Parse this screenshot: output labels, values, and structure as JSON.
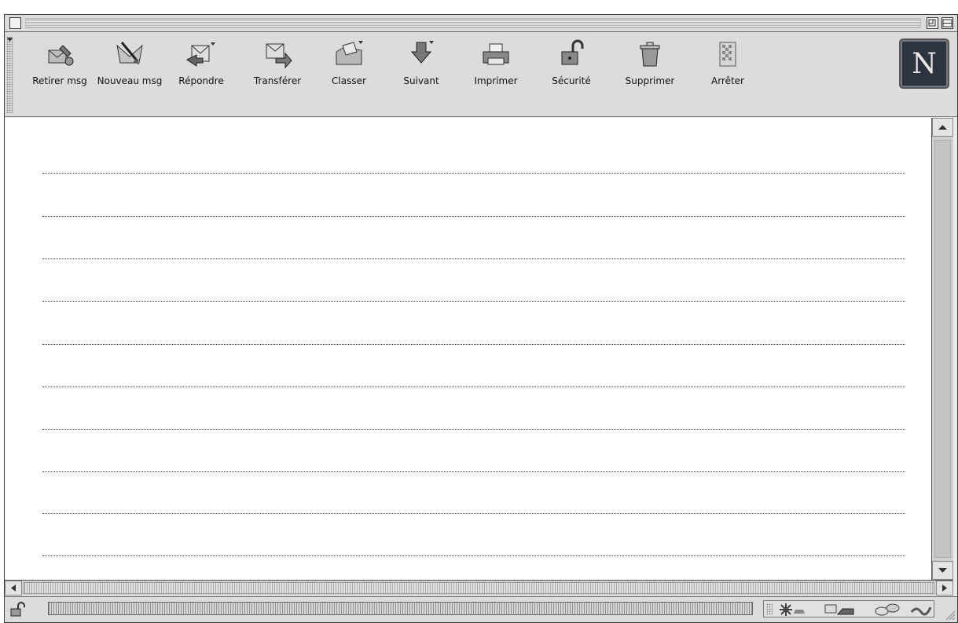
{
  "window": {
    "title": "",
    "close_icon": "close-box-icon",
    "zoom_icon": "zoom-box-icon",
    "collapse_icon": "collapse-box-icon"
  },
  "toolbar": {
    "buttons": [
      {
        "id": "get-msg",
        "label": "Retirer msg",
        "icon": "get-mail-icon"
      },
      {
        "id": "new-msg",
        "label": "Nouveau msg",
        "icon": "new-message-icon"
      },
      {
        "id": "reply",
        "label": "Répondre",
        "icon": "reply-icon"
      },
      {
        "id": "forward",
        "label": "Transférer",
        "icon": "forward-icon"
      },
      {
        "id": "file",
        "label": "Classer",
        "icon": "file-folder-icon"
      },
      {
        "id": "next",
        "label": "Suivant",
        "icon": "next-arrow-icon"
      },
      {
        "id": "print",
        "label": "Imprimer",
        "icon": "printer-icon"
      },
      {
        "id": "security",
        "label": "Sécurité",
        "icon": "padlock-icon"
      },
      {
        "id": "delete",
        "label": "Supprimer",
        "icon": "trash-icon"
      },
      {
        "id": "stop",
        "label": "Arrêter",
        "icon": "stop-icon"
      }
    ],
    "logo": {
      "letter": "N",
      "icon": "netscape-logo"
    }
  },
  "message_list": {
    "row_count": 10
  },
  "status": {
    "text": "",
    "progress": 0,
    "security_icon": "unlocked-padlock-icon",
    "components": [
      "navigator-icon",
      "mail-icon",
      "discussions-icon",
      "composer-icon"
    ]
  },
  "colors": {
    "chrome": "#dcdcdc",
    "content_bg": "#ffffff",
    "logo_bg": "#2c3440"
  }
}
